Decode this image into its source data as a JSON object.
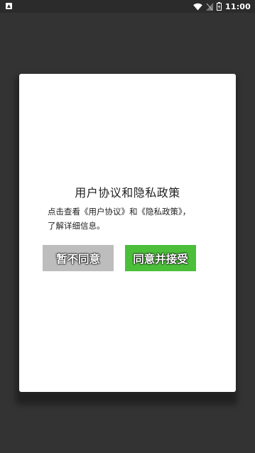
{
  "status_bar": {
    "time": "11:00",
    "icons": [
      "notification-icon",
      "wifi-icon",
      "signal-icon",
      "battery-icon"
    ]
  },
  "dialog": {
    "title": "用户协议和隐私政策",
    "body_line1": "点击查看《用户协议》和《隐私政策》，",
    "body_line2": "了解详细信息。",
    "disagree_label": "暂不同意",
    "agree_label": "同意并接受"
  },
  "colors": {
    "background": "#333333",
    "dialog": "#ffffff",
    "disagree_button": "#bdbdbd",
    "agree_button": "#4bbf3a"
  }
}
